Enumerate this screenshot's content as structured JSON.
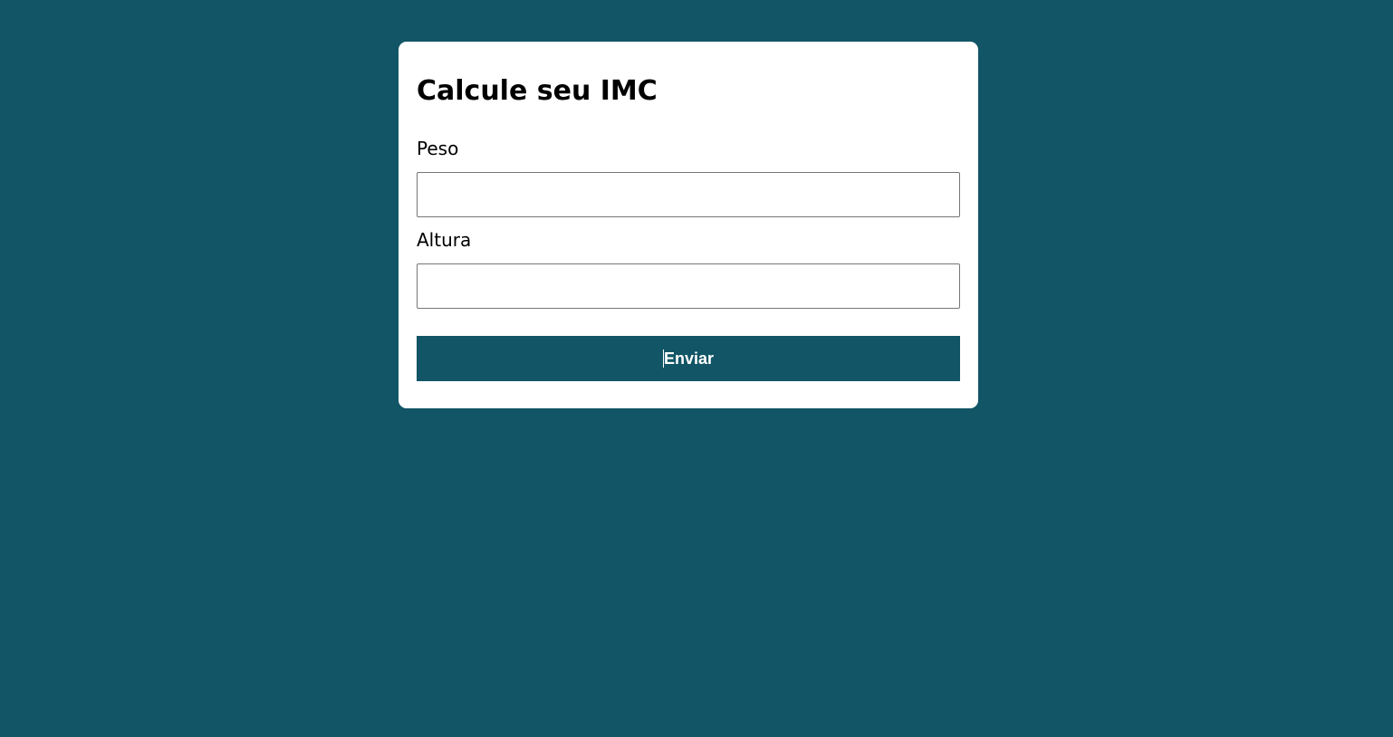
{
  "form": {
    "title": "Calcule seu IMC",
    "peso_label": "Peso",
    "peso_value": "",
    "altura_label": "Altura",
    "altura_value": "",
    "submit_label": "Enviar"
  },
  "colors": {
    "background": "#115566",
    "card": "#ffffff",
    "button": "#115566",
    "button_text": "#ffffff"
  }
}
